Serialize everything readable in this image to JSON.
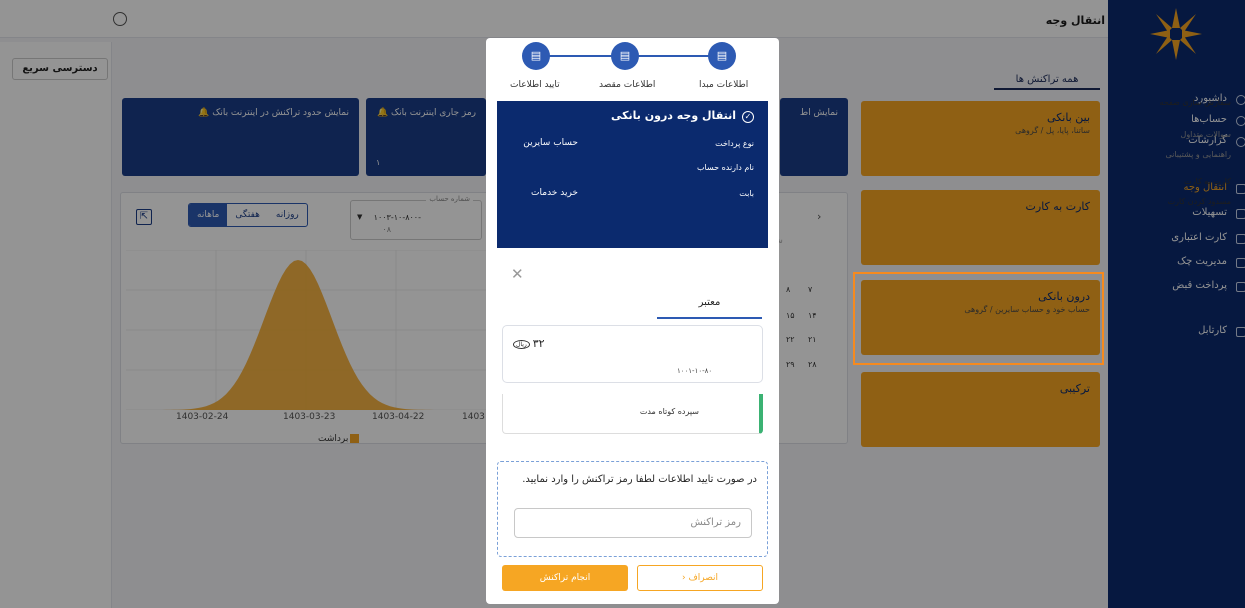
{
  "header": {
    "title": "انتقال وجه"
  },
  "sidenav": {
    "items": [
      {
        "label": "داشبورد",
        "active": false
      },
      {
        "label": "حساب‌ها",
        "active": false
      },
      {
        "label": "گزارشات",
        "active": false
      },
      {
        "label": "انتقال وجه",
        "active": true
      },
      {
        "label": "تسهیلات",
        "active": false
      },
      {
        "label": "کارت اعتباری",
        "active": false
      },
      {
        "label": "مدیریت چک",
        "active": false
      },
      {
        "label": "پرداخت قبض",
        "active": false
      },
      {
        "label": "کارتابل",
        "active": false
      }
    ]
  },
  "tabs": {
    "all_transactions": "همه تراکنش ها"
  },
  "transfer_cards": [
    {
      "title": "بین بانکی",
      "subtitle": "ساتنا، پایا، پل / گروهی"
    },
    {
      "title": "کارت به کارت",
      "subtitle": ""
    },
    {
      "title": "درون بانکی",
      "subtitle": "حساب خود و حساب سایرین / گروهی"
    },
    {
      "title": "ترکیبی",
      "subtitle": ""
    }
  ],
  "quick_access": {
    "button": "دسترسی سریع",
    "items": [
      {
        "label": "سفارش سازی صفحه",
        "dim": false
      },
      {
        "label": "سوالات متداول",
        "dim": true
      },
      {
        "label": "راهنمایی و پشتیبانی",
        "dim": true
      },
      {
        "label": "کارت به کارت",
        "dim": false
      },
      {
        "label": "مسدود کردن کارت",
        "dim": false
      }
    ]
  },
  "dashboard_cards": {
    "card1": "نمایش حدود تراکنش در اینترنت بانک",
    "card2": "رمز جاری اینترنت بانک",
    "card2_value": "۱",
    "card3": "نمایش اط"
  },
  "chart": {
    "period_tabs": [
      "روزانه",
      "هفتگی",
      "ماهانه"
    ],
    "active_period": "ماهانه",
    "account_label": "شماره حساب",
    "account_value": "۱۰۰۳-۱۰-۸۰۰-",
    "account_sub": "۰۸",
    "x_ticks": [
      "1403-02-24",
      "1403-03-23",
      "1403-04-22",
      "1403"
    ],
    "legend": "برداشت",
    "calendar_nums": [
      "۷",
      "۸",
      "۱۴",
      "۱۵",
      "۲۱",
      "۲۲",
      "۲۸",
      "۲۹"
    ]
  },
  "chart_data": {
    "type": "area",
    "series": [
      {
        "name": "برداشت",
        "color": "#f6a623"
      }
    ],
    "x": [
      "1403-02-24",
      "1403-03-23",
      "1403-04-22",
      "1403"
    ],
    "grid": true,
    "legend": "bottom"
  },
  "wizard": {
    "steps": [
      "اطلاعات مبدا",
      "اطلاعات مقصد",
      "تایید اطلاعات"
    ],
    "summary_title": "انتقال وجه درون بانکی",
    "rows": [
      {
        "key": "نوع پرداخت",
        "value": "حساب سایرین"
      },
      {
        "key": "نام دارنده حساب",
        "value": ""
      },
      {
        "key": "بابت",
        "value": "خرید خدمات"
      }
    ],
    "low_card": "سپرده کوتاه مدت",
    "password_prompt": "در صورت تایید اطلاعات لطفا رمز تراکنش را وارد نمایید.",
    "password_placeholder": "رمز تراکنش",
    "cancel": "انصراف",
    "submit": "انجام تراکنش"
  },
  "popup": {
    "tab": "معتبر",
    "amount": "۳۲",
    "currency": "ریال",
    "account": "۱۰۰۱-۱۰-۸۰"
  },
  "colors": {
    "navy": "#0b2a6e",
    "accent": "#f6a623",
    "blue": "#2d5ab3",
    "highlight": "#f68a1e"
  }
}
